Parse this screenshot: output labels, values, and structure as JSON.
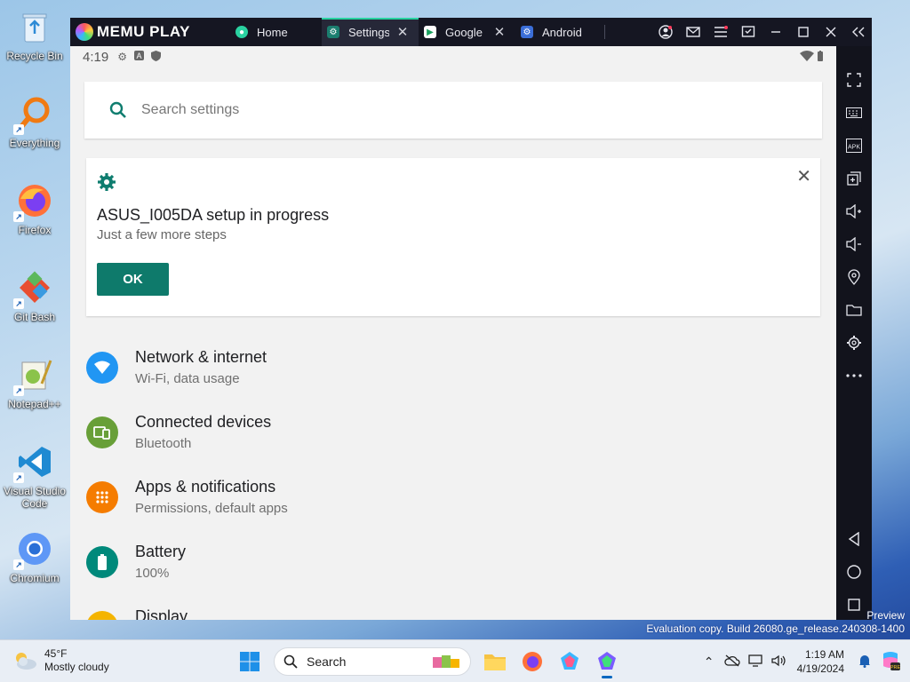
{
  "desktop": {
    "icons": [
      {
        "label": "Recycle Bin",
        "icon": "recycle-bin-icon"
      },
      {
        "label": "Everything",
        "icon": "magnifier-icon"
      },
      {
        "label": "Firefox",
        "icon": "firefox-icon"
      },
      {
        "label": "Git Bash",
        "icon": "git-icon"
      },
      {
        "label": "Notepad++",
        "icon": "notepad-icon"
      },
      {
        "label": "Visual Studio Code",
        "icon": "vscode-icon"
      },
      {
        "label": "Chromium",
        "icon": "chromium-icon"
      }
    ]
  },
  "emulator": {
    "logo_text": "MEMU PLAY",
    "tabs": [
      {
        "label": "Home",
        "icon": "home-app-icon",
        "color": "#2ad2a1"
      },
      {
        "label": "Settings",
        "icon": "settings-app-icon",
        "color": "#1b7e6f"
      },
      {
        "label": "Google I",
        "icon": "google-play-icon",
        "color": "#1aa260"
      },
      {
        "label": "Android",
        "icon": "android-settings-icon",
        "color": "#3b6ed8"
      }
    ],
    "status": {
      "time": "4:19"
    },
    "search": {
      "placeholder": "Search settings"
    },
    "suggestion": {
      "title": "ASUS_I005DA setup in progress",
      "subtitle": "Just a few more steps",
      "button": "OK"
    },
    "settings": [
      {
        "title": "Network & internet",
        "subtitle": "Wi-Fi, data usage",
        "icon": "wifi-icon",
        "color": "#2196f3"
      },
      {
        "title": "Connected devices",
        "subtitle": "Bluetooth",
        "icon": "devices-icon",
        "color": "#689f38"
      },
      {
        "title": "Apps & notifications",
        "subtitle": "Permissions, default apps",
        "icon": "apps-icon",
        "color": "#f57c00"
      },
      {
        "title": "Battery",
        "subtitle": "100%",
        "icon": "battery-icon",
        "color": "#00897b"
      },
      {
        "title": "Display",
        "subtitle": "",
        "icon": "display-icon",
        "color": "#f4b400"
      }
    ]
  },
  "watermark": {
    "line1": "Preview",
    "line2": "Evaluation copy. Build 26080.ge_release.240308-1400"
  },
  "taskbar": {
    "weather_temp": "45°F",
    "weather_desc": "Mostly cloudy",
    "search_label": "Search",
    "time": "1:19 AM",
    "date": "4/19/2024"
  }
}
